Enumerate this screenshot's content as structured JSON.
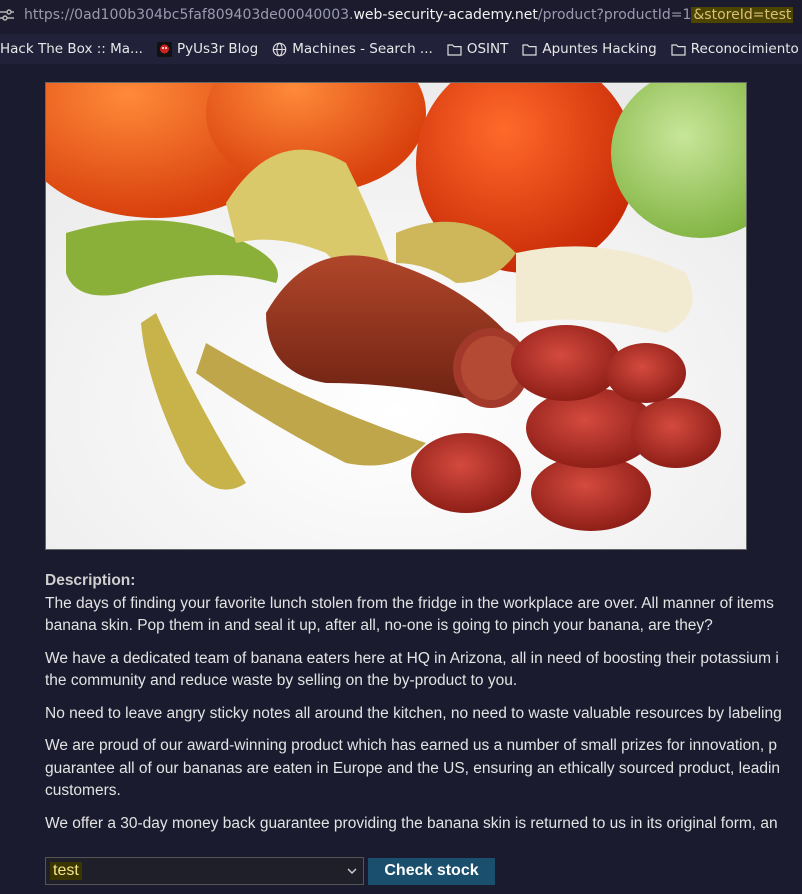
{
  "browser": {
    "url": {
      "prefix": "https://0ad100b304bc5faf809403de00040003.",
      "domain": "web-security-academy.net",
      "path": "/product?productId=1",
      "highlighted_param": "&storeId=test"
    },
    "bookmarks": [
      {
        "label": "Hack The Box :: Ma...",
        "icon": "none"
      },
      {
        "label": "PyUs3r Blog",
        "icon": "pyus3r-icon"
      },
      {
        "label": "Machines - Search ...",
        "icon": "globe-icon"
      },
      {
        "label": "OSINT",
        "icon": "folder-icon"
      },
      {
        "label": "Apuntes Hacking",
        "icon": "folder-icon"
      },
      {
        "label": "Reconocimiento",
        "icon": "folder-icon"
      }
    ]
  },
  "product": {
    "description_label": "Description:",
    "paragraphs": [
      [
        "The days of finding your favorite lunch stolen from the fridge in the workplace are over. All manner of items",
        "banana skin. Pop them in and seal it up, after all, no-one is going to pinch your banana, are they?"
      ],
      [
        "We have a dedicated team of banana eaters here at HQ in Arizona, all in need of boosting their potassium i",
        "the community and reduce waste by selling on the by-product to you."
      ],
      [
        "No need to leave angry sticky notes all around the kitchen, no need to waste valuable resources by labeling"
      ],
      [
        "We are proud of our award-winning product which has earned us a number of small prizes for innovation, p",
        "guarantee all of our bananas are eaten in Europe and the US, ensuring an ethically sourced product, leadin",
        "customers."
      ],
      [
        "We offer a 30-day money back guarantee providing the banana skin is returned to us in its original form, an"
      ]
    ]
  },
  "stock_check": {
    "store_value": "test",
    "button_label": "Check stock"
  },
  "colors": {
    "page_bg": "#1a1b2e",
    "button_bg": "#1b4f6e",
    "highlight": "#4d4400"
  }
}
